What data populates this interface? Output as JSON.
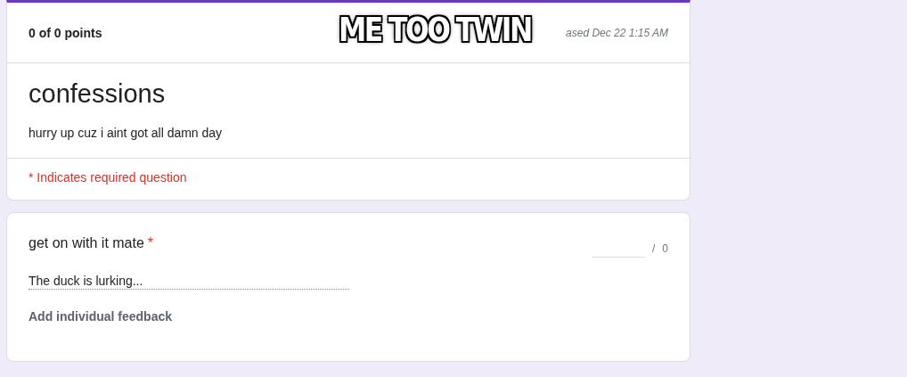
{
  "header": {
    "score": "0 of 0 points",
    "released": "ased Dec 22 1:15 AM"
  },
  "form": {
    "title": "confessions",
    "description": "hurry up cuz i aint got all damn day",
    "required_note": "* Indicates required question"
  },
  "question": {
    "title": "get on with it mate",
    "required_marker": "*",
    "points_separator": "/",
    "max_points": "0",
    "answer": "The duck is lurking...",
    "feedback_link": "Add individual feedback"
  },
  "caption": "ME TOO TWIN"
}
